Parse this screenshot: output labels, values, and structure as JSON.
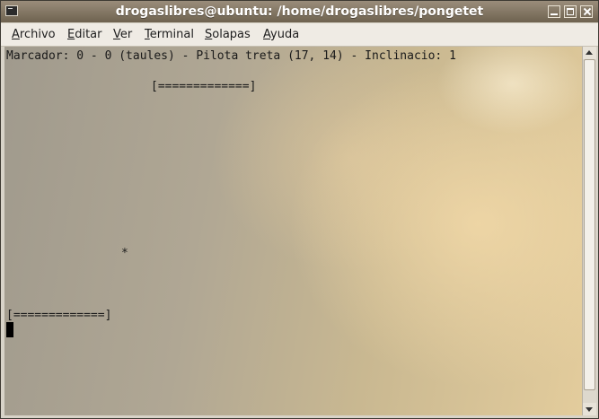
{
  "window": {
    "title": "drogaslibres@ubuntu: /home/drogaslibres/pongetet",
    "icons": [
      "terminal-icon",
      "minimize-icon",
      "maximize-icon",
      "close-icon"
    ]
  },
  "menu": {
    "items": [
      {
        "mnemonic": "A",
        "rest": "rchivo"
      },
      {
        "mnemonic": "E",
        "rest": "ditar"
      },
      {
        "mnemonic": "V",
        "rest": "er"
      },
      {
        "mnemonic": "T",
        "rest": "erminal"
      },
      {
        "mnemonic": "S",
        "rest": "olapas"
      },
      {
        "mnemonic": "A",
        "rest": "yuda"
      }
    ]
  },
  "terminal": {
    "status_line": "Marcador: 0 - 0 (taules) - Pilota treta (17, 14) - Inclinacio: 1",
    "top_paddle": "[=============]",
    "ball": "*",
    "bottom_paddle": "[=============]"
  },
  "colors": {
    "titlebar": "#7f7360",
    "menubar": "#efebe4",
    "terminal_text": "#1a1a1a",
    "cursor": "#000000"
  }
}
